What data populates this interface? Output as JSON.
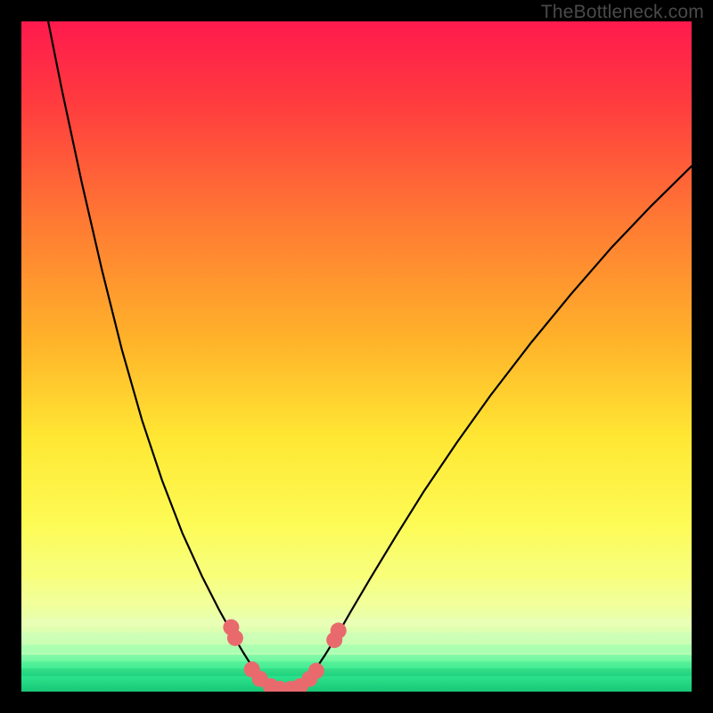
{
  "watermark": "TheBottleneck.com",
  "chart_data": {
    "type": "line",
    "title": "",
    "xlabel": "",
    "ylabel": "",
    "xlim": [
      0,
      100
    ],
    "ylim": [
      0,
      100
    ],
    "gradient_stops": [
      {
        "offset": 0.0,
        "color": "#ff1a4d"
      },
      {
        "offset": 0.12,
        "color": "#ff3b3f"
      },
      {
        "offset": 0.3,
        "color": "#ff7a33"
      },
      {
        "offset": 0.48,
        "color": "#ffb42a"
      },
      {
        "offset": 0.62,
        "color": "#ffe733"
      },
      {
        "offset": 0.75,
        "color": "#fdfb55"
      },
      {
        "offset": 0.84,
        "color": "#f6ff86"
      },
      {
        "offset": 0.9,
        "color": "#e7ffb0"
      },
      {
        "offset": 0.945,
        "color": "#b6ffb6"
      },
      {
        "offset": 0.965,
        "color": "#63f79e"
      },
      {
        "offset": 0.975,
        "color": "#2fe58e"
      },
      {
        "offset": 1.0,
        "color": "#17c877"
      }
    ],
    "bottom_bands": [
      {
        "y": 0.965,
        "color": "#17c877"
      },
      {
        "y": 0.955,
        "color": "#2de58d"
      },
      {
        "y": 0.945,
        "color": "#5af39b"
      },
      {
        "y": 0.93,
        "color": "#9affad"
      },
      {
        "y": 0.912,
        "color": "#c9ffb8"
      },
      {
        "y": 0.89,
        "color": "#e9ffb9"
      },
      {
        "y": 0.86,
        "color": "#f6ff9a"
      },
      {
        "y": 0.82,
        "color": "#fbff70"
      }
    ],
    "series": [
      {
        "name": "curve",
        "stroke": "#000000",
        "stroke_width": 2.2,
        "points": [
          {
            "x": 4.0,
            "y": 100.0
          },
          {
            "x": 6.0,
            "y": 90.0
          },
          {
            "x": 9.0,
            "y": 76.0
          },
          {
            "x": 12.0,
            "y": 63.0
          },
          {
            "x": 15.0,
            "y": 51.0
          },
          {
            "x": 18.0,
            "y": 40.5
          },
          {
            "x": 21.0,
            "y": 31.5
          },
          {
            "x": 24.0,
            "y": 23.7
          },
          {
            "x": 27.0,
            "y": 17.1
          },
          {
            "x": 29.5,
            "y": 12.2
          },
          {
            "x": 31.5,
            "y": 8.6
          },
          {
            "x": 33.0,
            "y": 6.0
          },
          {
            "x": 34.2,
            "y": 4.1
          },
          {
            "x": 35.4,
            "y": 2.6
          },
          {
            "x": 36.4,
            "y": 1.6
          },
          {
            "x": 37.2,
            "y": 0.9
          },
          {
            "x": 38.0,
            "y": 0.5
          },
          {
            "x": 39.0,
            "y": 0.3
          },
          {
            "x": 40.0,
            "y": 0.3
          },
          {
            "x": 41.0,
            "y": 0.5
          },
          {
            "x": 41.8,
            "y": 0.9
          },
          {
            "x": 42.6,
            "y": 1.7
          },
          {
            "x": 43.8,
            "y": 3.2
          },
          {
            "x": 45.2,
            "y": 5.3
          },
          {
            "x": 47.0,
            "y": 8.2
          },
          {
            "x": 49.0,
            "y": 11.7
          },
          {
            "x": 52.0,
            "y": 16.8
          },
          {
            "x": 56.0,
            "y": 23.4
          },
          {
            "x": 60.0,
            "y": 29.8
          },
          {
            "x": 65.0,
            "y": 37.2
          },
          {
            "x": 70.0,
            "y": 44.2
          },
          {
            "x": 76.0,
            "y": 52.0
          },
          {
            "x": 82.0,
            "y": 59.3
          },
          {
            "x": 88.0,
            "y": 66.2
          },
          {
            "x": 94.0,
            "y": 72.5
          },
          {
            "x": 100.0,
            "y": 78.4
          }
        ]
      }
    ],
    "markers": {
      "color": "#e96a6d",
      "radius_scale": 0.012,
      "points": [
        {
          "x": 31.3,
          "y": 9.6
        },
        {
          "x": 31.9,
          "y": 8.0
        },
        {
          "x": 34.4,
          "y": 3.3
        },
        {
          "x": 35.6,
          "y": 1.9
        },
        {
          "x": 37.2,
          "y": 0.8
        },
        {
          "x": 38.6,
          "y": 0.4
        },
        {
          "x": 40.2,
          "y": 0.4
        },
        {
          "x": 41.6,
          "y": 0.8
        },
        {
          "x": 43.0,
          "y": 1.9
        },
        {
          "x": 44.0,
          "y": 3.1
        },
        {
          "x": 46.7,
          "y": 7.7
        },
        {
          "x": 47.3,
          "y": 9.1
        }
      ]
    }
  }
}
